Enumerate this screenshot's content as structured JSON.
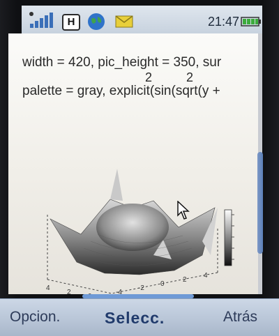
{
  "status_bar": {
    "network_type": "H",
    "time": "21:47",
    "icons": [
      "signal-strength-icon",
      "network-h-icon",
      "globe-icon",
      "mail-icon",
      "battery-icon"
    ]
  },
  "content": {
    "code_line_1": "width = 420, pic_height = 350, sur",
    "code_superscript": "2 2",
    "code_line_2": "palette = gray, explicit(sin(sqrt(y  +"
  },
  "plot": {
    "x_ticks": [
      "4",
      "2",
      "0",
      "-2",
      "-4"
    ],
    "y_ticks": [
      "-4",
      "-2",
      "0",
      "2",
      "4"
    ],
    "colorbar": "gray palette"
  },
  "softkeys": {
    "left": "Opcion.",
    "center": "Selecc.",
    "right": "Atrás"
  },
  "colors": {
    "statusbar_bg": "#d5dde7",
    "softkey_text": "#2d3b59",
    "scroll_thumb": "#5b7fb7"
  }
}
